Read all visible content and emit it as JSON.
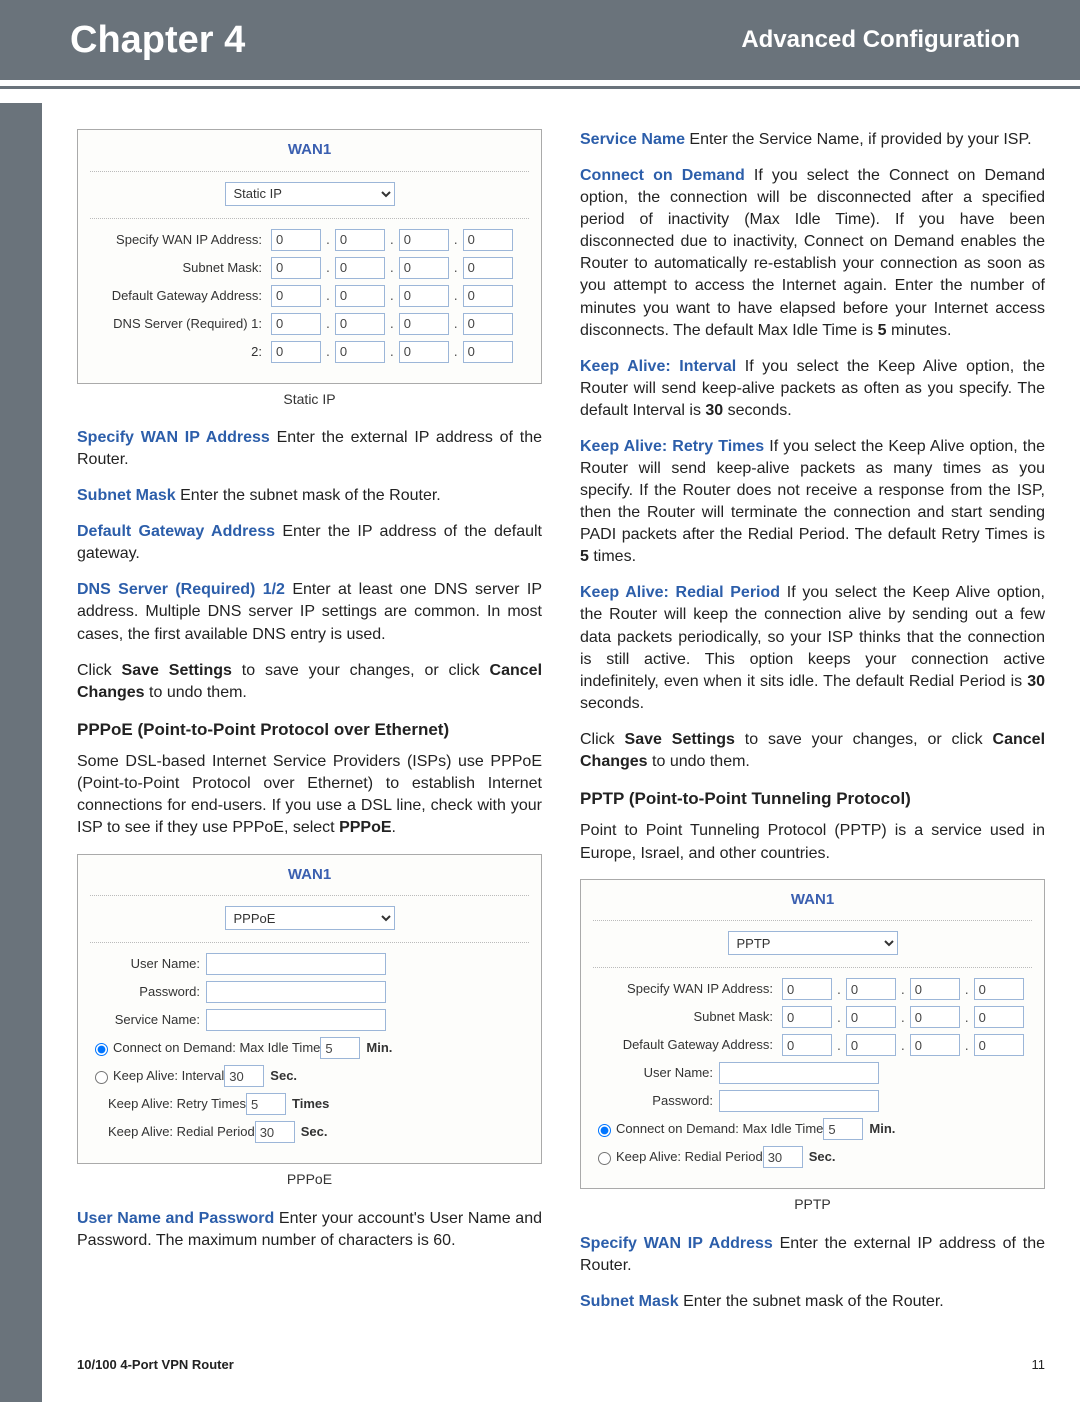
{
  "banner": {
    "chapter": "Chapter 4",
    "section": "Advanced Configuration"
  },
  "left": {
    "screenshot1": {
      "title": "WAN1",
      "select": "Static IP",
      "rows": [
        {
          "label": "Specify WAN IP Address:",
          "a": "0",
          "b": "0",
          "c": "0",
          "d": "0"
        },
        {
          "label": "Subnet Mask:",
          "a": "0",
          "b": "0",
          "c": "0",
          "d": "0"
        },
        {
          "label": "Default Gateway Address:",
          "a": "0",
          "b": "0",
          "c": "0",
          "d": "0"
        },
        {
          "label": "DNS Server (Required) 1:",
          "a": "0",
          "b": "0",
          "c": "0",
          "d": "0"
        },
        {
          "label": "2:",
          "a": "0",
          "b": "0",
          "c": "0",
          "d": "0"
        }
      ],
      "caption": "Static IP"
    },
    "p1": {
      "lead": "Specify WAN IP Address",
      "rest": "  Enter the external IP address of the Router."
    },
    "p2": {
      "lead": "Subnet Mask",
      "rest": "  Enter the subnet mask of the Router."
    },
    "p3": {
      "lead": "Default Gateway Address",
      "rest": "  Enter the IP address of the default gateway."
    },
    "p4": {
      "lead": "DNS Server (Required) 1/2",
      "rest": "  Enter at least one DNS server IP address. Multiple DNS server IP settings are common. In most cases, the first available DNS entry is used."
    },
    "p5": {
      "a": "Click ",
      "b": "Save Settings",
      "c": " to save your changes, or click ",
      "d": "Cancel Changes",
      "e": " to undo them."
    },
    "h1": "PPPoE (Point-to-Point Protocol over Ethernet)",
    "p6": {
      "a": "Some DSL-based Internet Service Providers (ISPs) use PPPoE (Point-to-Point Protocol over Ethernet) to establish Internet connections for end-users. If you use a DSL line, check with your ISP to see if they use PPPoE, select ",
      "b": "PPPoE",
      "c": "."
    },
    "screenshot2": {
      "title": "WAN1",
      "select": "PPPoE",
      "user": "User Name:",
      "pass": "Password:",
      "svc": "Service Name:",
      "cod": "Connect on Demand: Max Idle Time",
      "cod_v": "5",
      "cod_u": "Min.",
      "ka": "Keep Alive: Interval",
      "ka_v": "30",
      "ka_u": "Sec.",
      "rt": "Keep Alive: Retry Times",
      "rt_v": "5",
      "rt_u": "Times",
      "rp": "Keep Alive: Redial Period",
      "rp_v": "30",
      "rp_u": "Sec.",
      "caption": "PPPoE"
    },
    "p7": {
      "lead": "User Name and Password",
      "rest": "  Enter your account's User Name and Password. The maximum number of characters is 60."
    }
  },
  "right": {
    "p1": {
      "lead": "Service Name",
      "rest": "  Enter the Service Name, if provided by your ISP."
    },
    "p2": {
      "lead": "Connect on Demand",
      "rest": " If you select the Connect on Demand option, the connection will be disconnected after a specified period of inactivity (Max Idle Time). If you have been disconnected due to inactivity, Connect on Demand enables the Router to automatically re-establish your connection as soon as you attempt to access the Internet again. Enter the number of minutes you want to have elapsed before your Internet access disconnects. The default Max Idle Time is ",
      "b": "5",
      "c": " minutes."
    },
    "p3": {
      "lead": "Keep Alive: Interval",
      "rest": "  If you select the Keep Alive option, the Router will send keep-alive packets as often as you specify. The default Interval is ",
      "b": "30",
      "c": " seconds."
    },
    "p4": {
      "lead": "Keep Alive: Retry Times",
      "rest": "  If you select the Keep Alive option, the Router will send keep-alive packets as many times as you specify. If the Router does not receive a response from the ISP, then the Router will terminate the connection and start sending PADI packets after the Redial Period. The default Retry Times is ",
      "b": "5",
      "c": " times."
    },
    "p5": {
      "lead": "Keep Alive: Redial Period",
      "rest": "  If you select the Keep Alive option, the Router will keep the connection alive by sending out a few data packets periodically, so your ISP thinks that the connection is still active. This option keeps your connection active indefinitely, even when it sits idle. The default Redial Period is ",
      "b": "30",
      "c": " seconds."
    },
    "p6": {
      "a": "Click ",
      "b": "Save Settings",
      "c": " to save your changes, or click ",
      "d": "Cancel Changes",
      "e": " to undo them."
    },
    "h1": "PPTP (Point-to-Point Tunneling Protocol)",
    "p7": "Point to Point Tunneling Protocol (PPTP) is a service used in Europe, Israel, and other countries.",
    "screenshot3": {
      "title": "WAN1",
      "select": "PPTP",
      "rows": [
        {
          "label": "Specify WAN IP Address:",
          "a": "0",
          "b": "0",
          "c": "0",
          "d": "0"
        },
        {
          "label": "Subnet Mask:",
          "a": "0",
          "b": "0",
          "c": "0",
          "d": "0"
        },
        {
          "label": "Default Gateway Address:",
          "a": "0",
          "b": "0",
          "c": "0",
          "d": "0"
        }
      ],
      "user": "User Name:",
      "pass": "Password:",
      "cod": "Connect on Demand: Max Idle Time",
      "cod_v": "5",
      "cod_u": "Min.",
      "rp": "Keep Alive: Redial Period",
      "rp_v": "30",
      "rp_u": "Sec.",
      "caption": "PPTP"
    },
    "p8": {
      "lead": "Specify WAN IP Address",
      "rest": "  Enter the external IP address of the Router."
    },
    "p9": {
      "lead": "Subnet Mask",
      "rest": "  Enter the subnet mask of the Router."
    }
  },
  "footer": {
    "l": "10/100 4-Port VPN Router",
    "r": "11"
  }
}
